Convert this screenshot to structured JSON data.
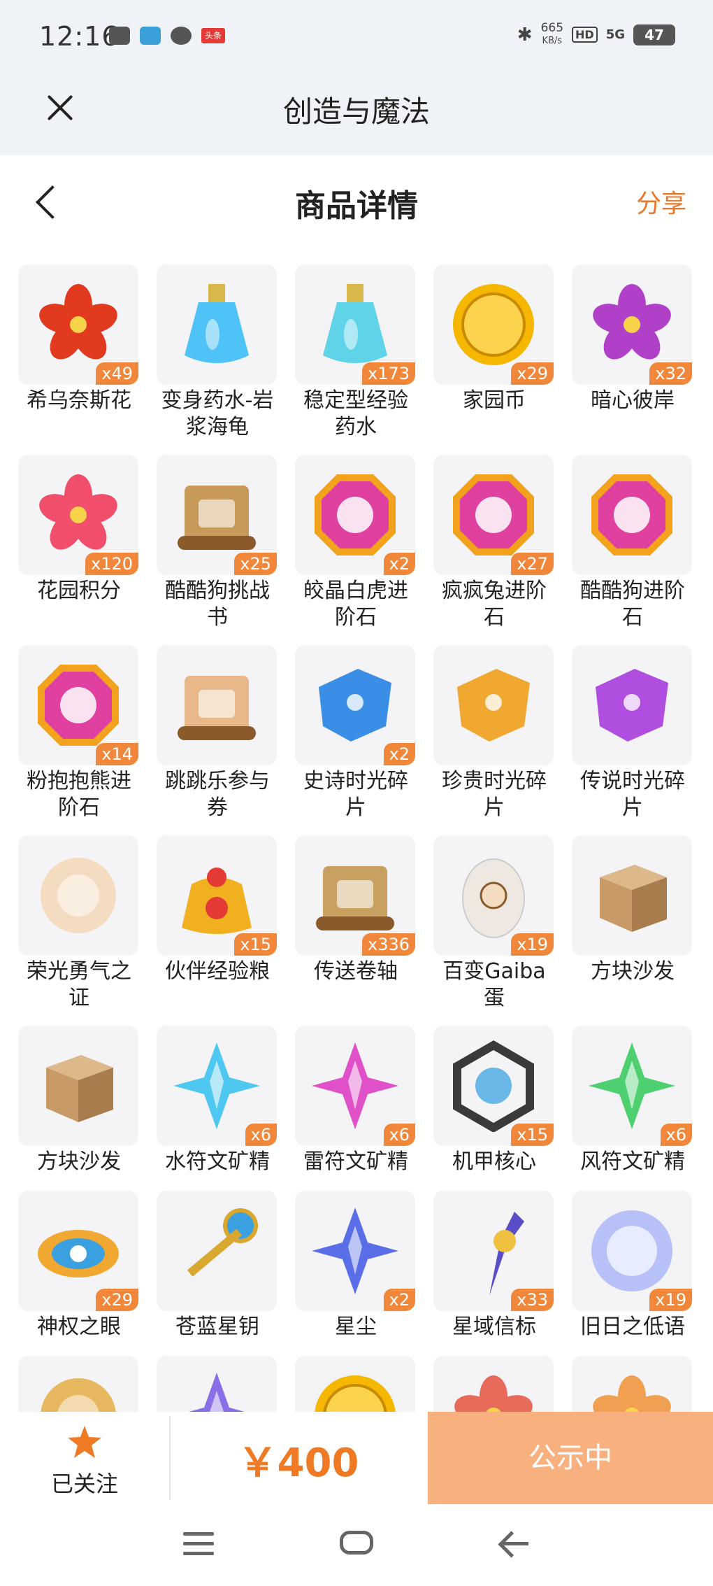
{
  "status_bar": {
    "time": "12:16",
    "net_speed": "665",
    "net_unit": "KB/s",
    "hd": "HD",
    "signal": "5G",
    "battery": "47",
    "news_icon_text": "头条"
  },
  "app_bar": {
    "title": "创造与魔法"
  },
  "nav_bar": {
    "title": "商品详情",
    "share": "分享"
  },
  "items": [
    {
      "name": "希乌奈斯花",
      "qty": "x49",
      "icon": "flower-red-icon",
      "color": "#e23a1e"
    },
    {
      "name": "变身药水-岩浆海龟",
      "qty": "",
      "icon": "potion-bottle-icon",
      "color": "#4fc3f7"
    },
    {
      "name": "稳定型经验药水",
      "qty": "x173",
      "icon": "potion-flask-icon",
      "color": "#5fd3e8"
    },
    {
      "name": "家园币",
      "qty": "x29",
      "icon": "gold-coin-icon",
      "color": "#f5b700"
    },
    {
      "name": "暗心彼岸",
      "qty": "x32",
      "icon": "spider-lily-icon",
      "color": "#b040c8"
    },
    {
      "name": "花园积分",
      "qty": "x120",
      "icon": "flower-badge-icon",
      "color": "#f04e6a"
    },
    {
      "name": "酷酷狗挑战书",
      "qty": "x25",
      "icon": "wanted-scroll-icon",
      "color": "#c89a5a"
    },
    {
      "name": "皎晶白虎进阶石",
      "qty": "x2",
      "icon": "tiger-gem-icon",
      "color": "#e040a0"
    },
    {
      "name": "疯疯兔进阶石",
      "qty": "x27",
      "icon": "rabbit-gem-icon",
      "color": "#e040a0"
    },
    {
      "name": "酷酷狗进阶石",
      "qty": "",
      "icon": "dog-gem-icon",
      "color": "#e040a0"
    },
    {
      "name": "粉抱抱熊进阶石",
      "qty": "x14",
      "icon": "egg-gem-icon",
      "color": "#e040a0"
    },
    {
      "name": "跳跳乐参与券",
      "qty": "",
      "icon": "ticket-icon",
      "color": "#e8b88a"
    },
    {
      "name": "史诗时光碎片",
      "qty": "x2",
      "icon": "shard-blue-icon",
      "color": "#3a8ee6"
    },
    {
      "name": "珍贵时光碎片",
      "qty": "",
      "icon": "shard-gold-icon",
      "color": "#f0a830"
    },
    {
      "name": "传说时光碎片",
      "qty": "",
      "icon": "shard-purple-icon",
      "color": "#b04ee0"
    },
    {
      "name": "荣光勇气之证",
      "qty": "",
      "icon": "honor-emblem-icon",
      "color": "#f3dcc0"
    },
    {
      "name": "伙伴经验粮",
      "qty": "x15",
      "icon": "food-bag-icon",
      "color": "#f0b020"
    },
    {
      "name": "传送卷轴",
      "qty": "x336",
      "icon": "teleport-scroll-icon",
      "color": "#c8a060"
    },
    {
      "name": "百变Gaiba蛋",
      "qty": "x19",
      "icon": "egg-icon",
      "color": "#eee8e0"
    },
    {
      "name": "方块沙发",
      "qty": "",
      "icon": "box-icon",
      "color": "#c89a68"
    },
    {
      "name": "方块沙发",
      "qty": "",
      "icon": "box-icon",
      "color": "#c89a68"
    },
    {
      "name": "水符文矿精",
      "qty": "x6",
      "icon": "crystal-cyan-icon",
      "color": "#4ec8f0"
    },
    {
      "name": "雷符文矿精",
      "qty": "x6",
      "icon": "crystal-pink-icon",
      "color": "#e050c8"
    },
    {
      "name": "机甲核心",
      "qty": "x15",
      "icon": "mech-core-icon",
      "color": "#3a3a3a"
    },
    {
      "name": "风符文矿精",
      "qty": "x6",
      "icon": "crystal-green-icon",
      "color": "#4ed070"
    },
    {
      "name": "神权之眼",
      "qty": "x29",
      "icon": "eye-crown-icon",
      "color": "#3aa0e0"
    },
    {
      "name": "苍蓝星钥",
      "qty": "",
      "icon": "star-key-icon",
      "color": "#d8a830"
    },
    {
      "name": "星尘",
      "qty": "x2",
      "icon": "stardust-crystal-icon",
      "color": "#5a6ee8"
    },
    {
      "name": "星域信标",
      "qty": "x33",
      "icon": "beacon-icon",
      "color": "#5a4ec8"
    },
    {
      "name": "旧日之低语",
      "qty": "x19",
      "icon": "orb-icon",
      "color": "#b8c0f8"
    },
    {
      "name": "",
      "qty": "",
      "icon": "sun-emblem-icon",
      "color": "#e8b860"
    },
    {
      "name": "",
      "qty": "",
      "icon": "crystal-violet-icon",
      "color": "#8a6ee8"
    },
    {
      "name": "",
      "qty": "",
      "icon": "gold-coin-icon",
      "color": "#f5b700"
    },
    {
      "name": "",
      "qty": "",
      "icon": "flower-red-icon",
      "color": "#e86a5a"
    },
    {
      "name": "",
      "qty": "",
      "icon": "flower-orange-icon",
      "color": "#f0a050"
    }
  ],
  "bottom_bar": {
    "follow_label": "已关注",
    "price": "￥400",
    "status_button": "公示中",
    "accent": "#f07a23"
  }
}
